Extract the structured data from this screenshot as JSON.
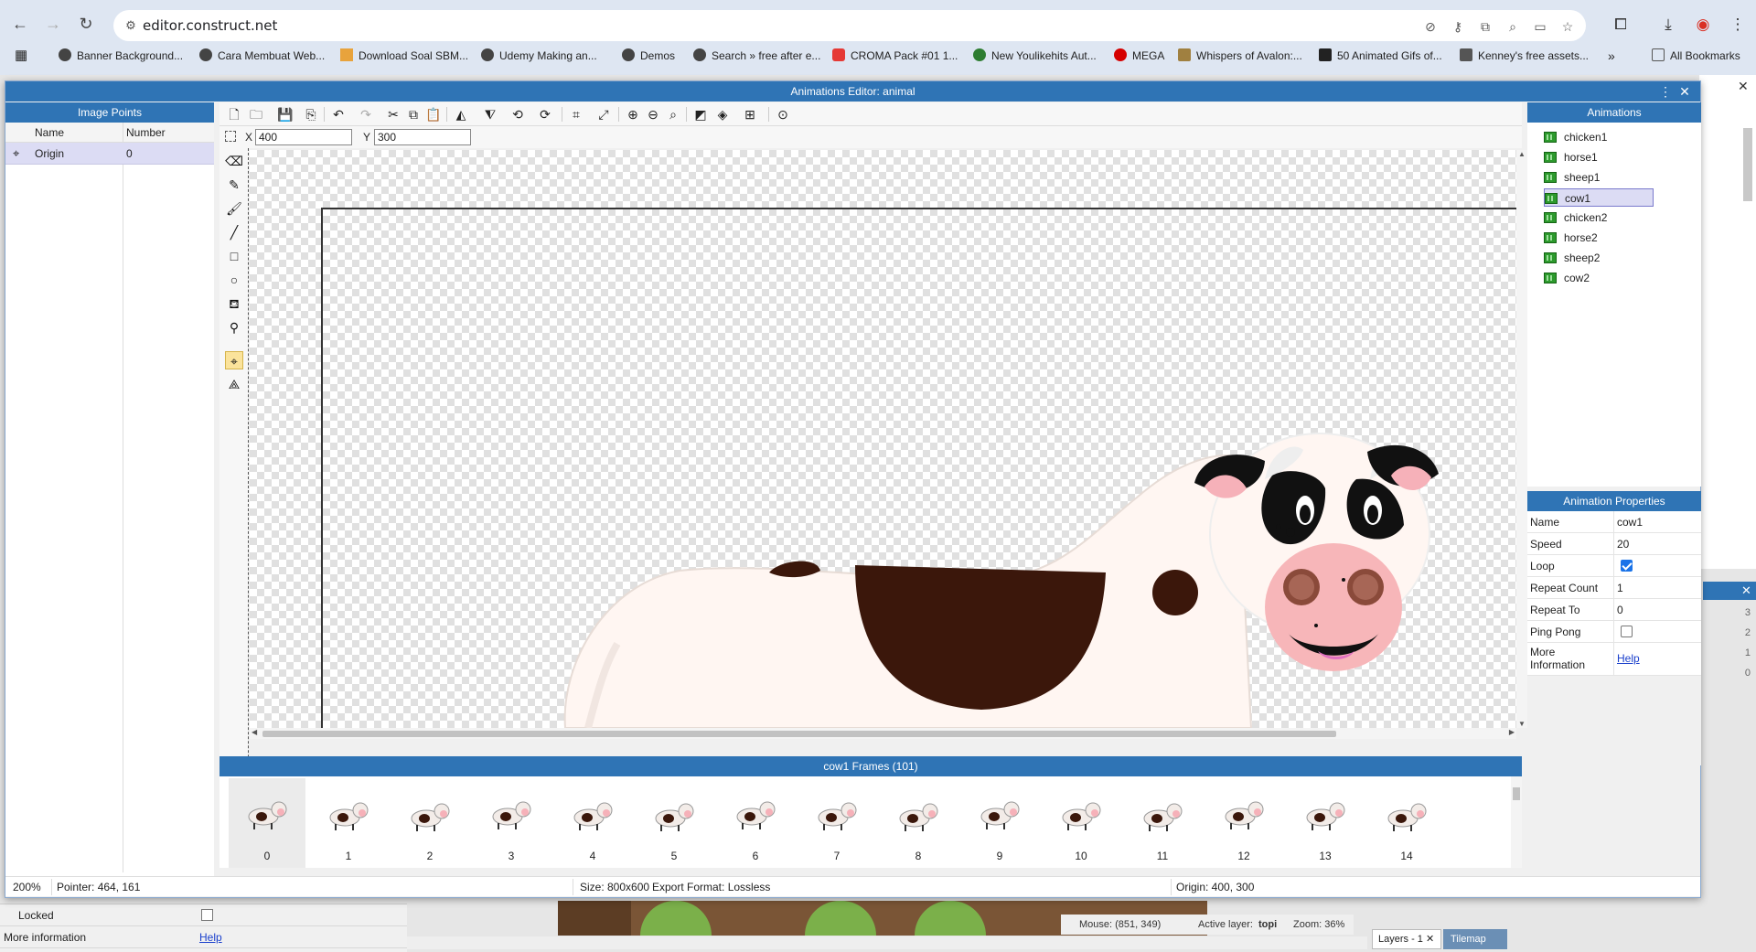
{
  "browser": {
    "url": "editor.construct.net",
    "bookmarks": [
      "Banner Background...",
      "Cara Membuat Web...",
      "Download Soal SBM...",
      "Udemy Making an...",
      "Demos",
      "Search » free after e...",
      "CROMA Pack #01 1...",
      "New Youlikehits Aut...",
      "MEGA",
      "Whispers of Avalon:...",
      "50 Animated Gifs of...",
      "Kenney's free assets..."
    ],
    "all_bookmarks": "All Bookmarks",
    "more_bookmarks": "»"
  },
  "dialog": {
    "title": "Animations Editor: animal",
    "menu_icon": "⋮",
    "close_icon": "✕"
  },
  "image_points": {
    "title": "Image Points",
    "columns": [
      "Name",
      "Number"
    ],
    "rows": [
      {
        "name": "Origin",
        "number": "0"
      }
    ]
  },
  "editor": {
    "x_label": "X",
    "x_value": "400",
    "y_label": "Y",
    "y_value": "300"
  },
  "animations": {
    "title": "Animations",
    "items": [
      "chicken1",
      "horse1",
      "sheep1",
      "cow1",
      "chicken2",
      "horse2",
      "sheep2",
      "cow2"
    ],
    "selected": "cow1"
  },
  "properties": {
    "title": "Animation Properties",
    "rows": [
      {
        "name": "Name",
        "value": "cow1"
      },
      {
        "name": "Speed",
        "value": "20"
      },
      {
        "name": "Loop",
        "checked": true
      },
      {
        "name": "Repeat Count",
        "value": "1"
      },
      {
        "name": "Repeat To",
        "value": "0"
      },
      {
        "name": "Ping Pong",
        "checked": false
      },
      {
        "name": "More Information",
        "link": "Help"
      }
    ]
  },
  "frames": {
    "title": "cow1 Frames (101)",
    "visible_numbers": [
      "0",
      "1",
      "2",
      "3",
      "4",
      "5",
      "6",
      "7",
      "8",
      "9",
      "10",
      "11",
      "12",
      "13",
      "14"
    ],
    "selected": "0"
  },
  "statusbar": {
    "zoom": "200%",
    "pointer": "Pointer: 464, 161",
    "size": "Size: 800x600",
    "export": "Export Format: Lossless",
    "origin": "Origin: 400, 300"
  },
  "background_page": {
    "locked_label": "Locked",
    "more_info_label": "More information",
    "help_link": "Help",
    "mouse": "Mouse: (851, 349)",
    "active_layer_label": "Active layer:",
    "active_layer_value": "topi",
    "zoom": "Zoom: 36%",
    "tab_layers": "Layers - 1",
    "tab_tilemap": "Tilemap",
    "layer_numbers": [
      "3",
      "2",
      "1",
      "0"
    ]
  },
  "colors": {
    "accent": "#2f74b5",
    "selection": "#dcdcf4",
    "checkbox": "#1a73e8"
  }
}
